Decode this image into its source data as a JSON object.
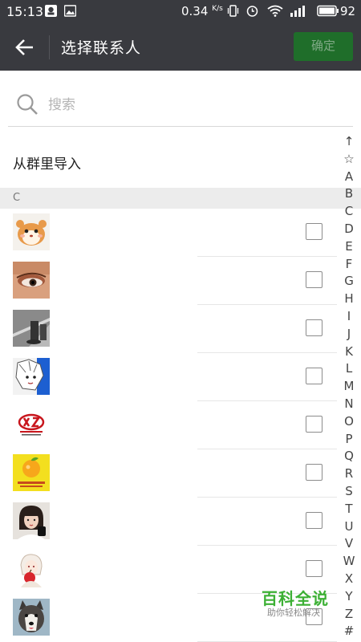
{
  "status_bar": {
    "time": "15:13",
    "speed_value": "0.34",
    "speed_unit": "K/s",
    "battery": "92",
    "icons": [
      "notification-icon",
      "image-icon",
      "vibrate-icon",
      "alarm-icon",
      "wifi-icon",
      "signal-icon",
      "battery-icon"
    ]
  },
  "app_bar": {
    "title": "选择联系人",
    "confirm_label": "确定",
    "back_icon": "back-arrow-icon"
  },
  "search": {
    "placeholder": "搜索",
    "value": ""
  },
  "import_row": {
    "label": "从群里导入"
  },
  "section": {
    "letter": "C"
  },
  "contacts": [
    {
      "avatar": "hamster-cartoon",
      "checked": false
    },
    {
      "avatar": "eye-makeup-photo",
      "checked": false
    },
    {
      "avatar": "street-bw-photo",
      "checked": false
    },
    {
      "avatar": "anime-character",
      "checked": false
    },
    {
      "avatar": "chuangxin-logo",
      "checked": false
    },
    {
      "avatar": "orange-logo",
      "checked": false
    },
    {
      "avatar": "girl-portrait",
      "checked": false
    },
    {
      "avatar": "anime-girl-apple",
      "checked": false
    },
    {
      "avatar": "husky-dog",
      "checked": false
    }
  ],
  "index_bar": [
    "↑",
    "☆",
    "A",
    "B",
    "C",
    "D",
    "E",
    "F",
    "G",
    "H",
    "I",
    "J",
    "K",
    "L",
    "M",
    "N",
    "O",
    "P",
    "Q",
    "R",
    "S",
    "T",
    "U",
    "V",
    "W",
    "X",
    "Y",
    "Z",
    "#"
  ],
  "watermark": {
    "title": "百科全说",
    "subtitle": "助你轻松解决"
  },
  "colors": {
    "bar_bg": "#393a3f",
    "confirm_bg": "#1f6e2a",
    "watermark_green": "#3cb034"
  }
}
